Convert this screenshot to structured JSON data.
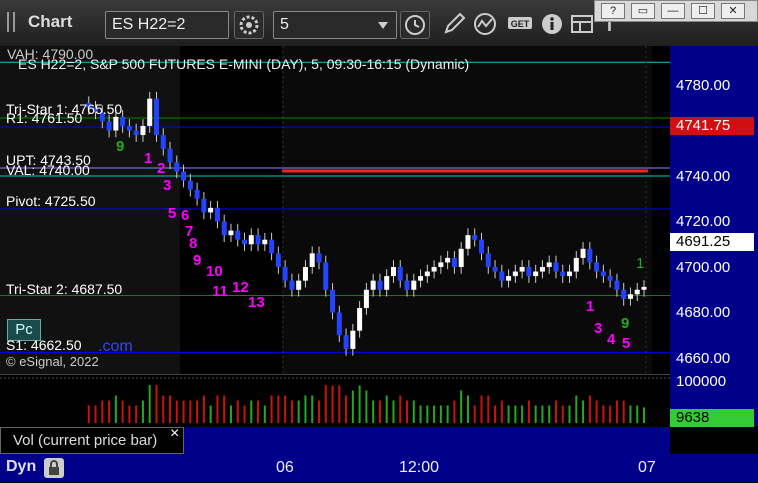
{
  "window": {
    "title": "Chart"
  },
  "toolbar": {
    "symbol": "ES H22=2",
    "interval": "5",
    "icons": [
      "settings-gear-icon",
      "clock-icon",
      "pencil-icon",
      "study-curve-icon",
      "get-icon",
      "info-icon",
      "layout-icon",
      "text-icon"
    ]
  },
  "window_buttons": {
    "help": "?",
    "restore": "▭",
    "minimize": "—",
    "maximize": "☐",
    "close": "✕"
  },
  "chart": {
    "header": "ES H22=2, S&P 500 FUTURES E-MINI (DAY), 5, 09:30-16:15 (Dynamic)",
    "copyright": "© eSignal, 2022",
    "levels": [
      {
        "label": "VAH: 4790.00",
        "value": 4790.0,
        "color": "#00cccc"
      },
      {
        "label": "Tri-Star 1: 4765.50",
        "value": 4765.5,
        "color": "#008800"
      },
      {
        "label": "R1: 4761.50",
        "value": 4761.5,
        "color": "#0000ff"
      },
      {
        "label": "UPT: 4743.50",
        "value": 4743.5,
        "color": "#8888ff"
      },
      {
        "label": "VAL: 4740.00",
        "value": 4740.0,
        "color": "#00cccc"
      },
      {
        "label": "Pivot: 4725.50",
        "value": 4725.5,
        "color": "#0000ff"
      },
      {
        "label": "Tri-Star 2: 4687.50",
        "value": 4687.5,
        "color": "#008800"
      },
      {
        "label": "S1: 4662.50",
        "value": 4662.5,
        "color": "#0000ff"
      }
    ],
    "price_ticks": [
      "4780.00",
      "4760.00",
      "4740.00",
      "4720.00",
      "4700.00",
      "4680.00",
      "4660.00"
    ],
    "current_price": "4691.25",
    "red_level": "4741.75",
    "counts_magenta": [
      "1",
      "2",
      "3",
      "5",
      "6",
      "7",
      "8",
      "9",
      "10",
      "11",
      "12",
      "13",
      "1",
      "3",
      "4",
      "5"
    ],
    "counts_green": [
      "9",
      "1",
      "9"
    ],
    "pc_button": "Pc",
    "com_text": ".com",
    "series": [
      4772,
      4770,
      4768,
      4764,
      4760,
      4766,
      4762,
      4760,
      4758,
      4762,
      4774,
      4758,
      4752,
      4746,
      4742,
      4738,
      4734,
      4730,
      4724,
      4726,
      4720,
      4714,
      4716,
      4712,
      4710,
      4714,
      4710,
      4712,
      4706,
      4700,
      4694,
      4690,
      4694,
      4700,
      4706,
      4702,
      4690,
      4680,
      4670,
      4664,
      4672,
      4682,
      4690,
      4694,
      4690,
      4696,
      4700,
      4694,
      4690,
      4694,
      4696,
      4698,
      4700,
      4702,
      4704,
      4700,
      4708,
      4714,
      4712,
      4706,
      4700,
      4698,
      4694,
      4696,
      4698,
      4700,
      4696,
      4698,
      4700,
      4702,
      4698,
      4696,
      4698,
      4704,
      4708,
      4702,
      4698,
      4696,
      4694,
      4690,
      4686,
      4688,
      4690,
      4691.25
    ]
  },
  "volume": {
    "axis_top": "100000",
    "current": "9638",
    "label": "Vol (current price bar)",
    "close_icon": "×"
  },
  "time_axis": {
    "labels": [
      "06",
      "12:00",
      "07"
    ]
  },
  "footer": {
    "tag": "Dyn"
  }
}
